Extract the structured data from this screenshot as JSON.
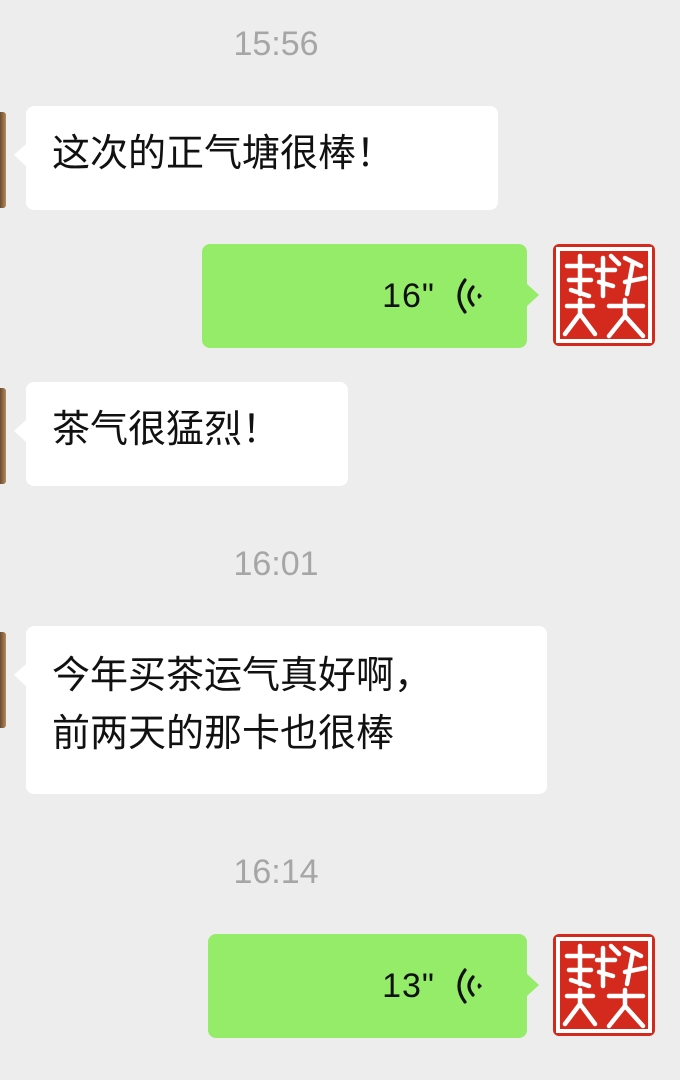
{
  "chat": {
    "timestamps": [
      "15:56",
      "16:01",
      "16:14"
    ],
    "messages": [
      {
        "side": "in",
        "type": "text",
        "text": "这次的正气塘很棒！"
      },
      {
        "side": "out",
        "type": "voice",
        "duration": "16\""
      },
      {
        "side": "in",
        "type": "text",
        "text": "茶气很猛烈！"
      },
      {
        "side": "in",
        "type": "text",
        "text": "今年买茶运气真好啊，\n前两天的那卡也很棒"
      },
      {
        "side": "out",
        "type": "voice",
        "duration": "13\""
      }
    ],
    "colors": {
      "background": "#ededed",
      "incoming_bubble": "#ffffff",
      "outgoing_bubble": "#95ec69",
      "timestamp_text": "#a6a6a6",
      "avatar_seal": "#d42a1e"
    },
    "icons": {
      "voice": "voice-wave-icon",
      "avatar": "red-seal-avatar"
    }
  }
}
